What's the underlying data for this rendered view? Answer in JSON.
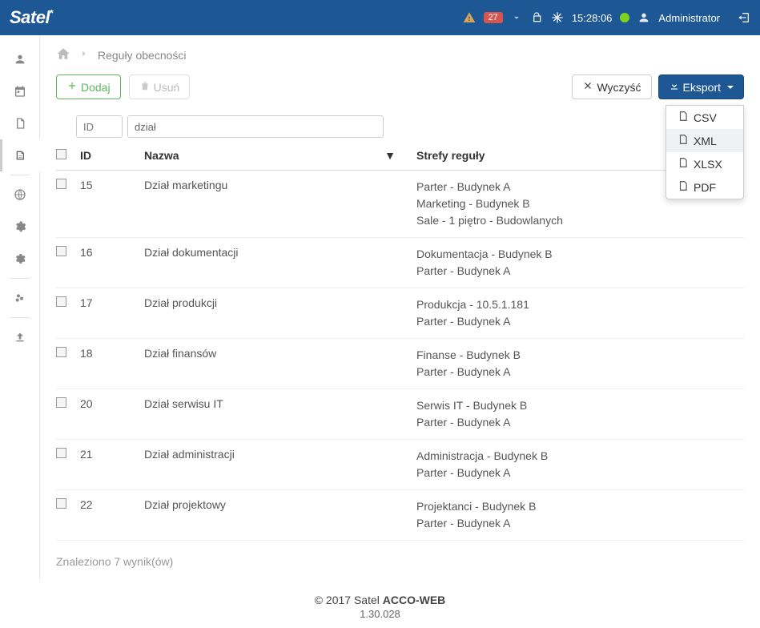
{
  "header": {
    "brand": "Satel",
    "alert_count": "27",
    "time": "15:28:06",
    "user_label": "Administrator"
  },
  "breadcrumb": {
    "current": "Reguły obecności"
  },
  "toolbar": {
    "add_label": "Dodaj",
    "delete_label": "Usuń",
    "clear_label": "Wyczyść",
    "export_label": "Eksport"
  },
  "export_menu": {
    "csv": "CSV",
    "xml": "XML",
    "xlsx": "XLSX",
    "pdf": "PDF"
  },
  "filters": {
    "id_placeholder": "ID",
    "name_value": "dział"
  },
  "columns": {
    "id": "ID",
    "name": "Nazwa",
    "zones": "Strefy reguły"
  },
  "rows": [
    {
      "id": "15",
      "name": "Dział marketingu",
      "zones": [
        "Parter - Budynek A",
        "Marketing - Budynek B",
        "Sale - 1 piętro - Budowlanych"
      ]
    },
    {
      "id": "16",
      "name": "Dział dokumentacji",
      "zones": [
        "Dokumentacja - Budynek B",
        "Parter - Budynek A"
      ]
    },
    {
      "id": "17",
      "name": "Dział produkcji",
      "zones": [
        "Produkcja - 10.5.1.181",
        "Parter - Budynek A"
      ]
    },
    {
      "id": "18",
      "name": "Dział finansów",
      "zones": [
        "Finanse - Budynek B",
        "Parter - Budynek A"
      ]
    },
    {
      "id": "20",
      "name": "Dział serwisu IT",
      "zones": [
        "Serwis IT - Budynek B",
        "Parter - Budynek A"
      ]
    },
    {
      "id": "21",
      "name": "Dział administracji",
      "zones": [
        "Administracja - Budynek B",
        "Parter - Budynek A"
      ]
    },
    {
      "id": "22",
      "name": "Dział projektowy",
      "zones": [
        "Projektanci - Budynek B",
        "Parter - Budynek A"
      ]
    }
  ],
  "result_text": "Znaleziono 7 wynik(ów)",
  "footer": {
    "copyright_prefix": "© 2017 Satel ",
    "app": "ACCO-WEB",
    "version": "1.30.028"
  }
}
